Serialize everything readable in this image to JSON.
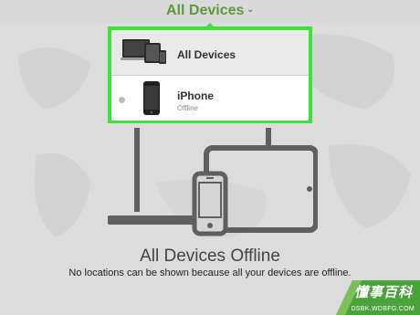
{
  "header": {
    "title": "All Devices",
    "chevron": "chevron-down-icon"
  },
  "dropdown": {
    "items": [
      {
        "label": "All Devices",
        "icon": "devices-group-icon",
        "selected": true
      },
      {
        "label": "iPhone",
        "status": "Offline",
        "icon": "iphone-icon",
        "status_dot": "offline-dot"
      }
    ]
  },
  "empty_state": {
    "title": "All Devices Offline",
    "message": "No locations can be shown because all your devices are offline."
  },
  "watermark": {
    "line1": "懂事百科",
    "line2": "DSBK.WDBFG.COM"
  },
  "colors": {
    "accent_green": "#5b9a3a",
    "highlight_border": "#3ee23a",
    "map_background": "#dcdcdc",
    "device_gray": "#5f5f5f"
  }
}
